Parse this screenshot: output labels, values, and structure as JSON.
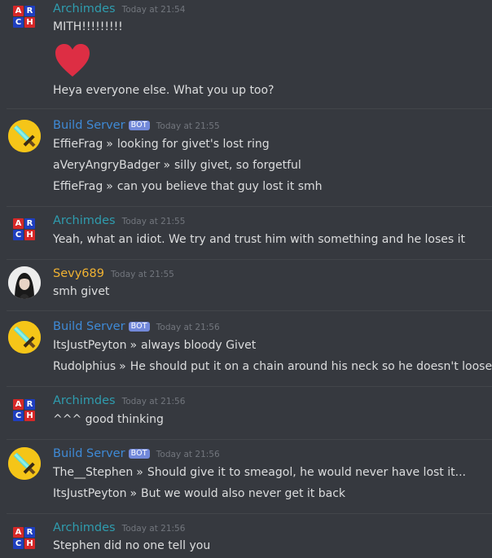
{
  "colors": {
    "background": "#36393f",
    "text": "#dcddde",
    "archimdes_name": "#2f9cae",
    "build_server_name": "#3f8ad6",
    "sevy_name": "#f0b232",
    "bot_tag": "#7289da",
    "timestamp": "#72767d",
    "heart": "#dd2e44"
  },
  "avatars": {
    "archimdes": {
      "icon": "arch-blocks-avatar-icon",
      "letters": [
        "A",
        "R",
        "C",
        "H"
      ]
    },
    "build_server": {
      "icon": "minecraft-sword-avatar-icon"
    },
    "sevy": {
      "icon": "profile-photo-avatar"
    }
  },
  "messages": [
    {
      "author": "Archimdes",
      "timestamp": "Today at 21:54",
      "lines": [
        "MITH!!!!!!!!!",
        "Heya everyone else. What you up too?"
      ],
      "emoji": "heart-emoji-icon"
    },
    {
      "author": "Build Server",
      "bot_tag": "BOT",
      "timestamp": "Today at 21:55",
      "relayed": [
        {
          "name": "EffieFrag",
          "sep": "»",
          "text": "looking for givet's lost ring"
        },
        {
          "name": "aVeryAngryBadger",
          "sep": "»",
          "text": "silly givet, so forgetful"
        },
        {
          "name": "EffieFrag",
          "sep": "»",
          "text": "can you believe that guy lost it smh"
        }
      ]
    },
    {
      "author": "Archimdes",
      "timestamp": "Today at 21:55",
      "lines": [
        "Yeah, what an idiot. We try and trust him with something and he loses it"
      ]
    },
    {
      "author": "Sevy689",
      "timestamp": "Today at 21:55",
      "lines": [
        "smh givet"
      ]
    },
    {
      "author": "Build Server",
      "bot_tag": "BOT",
      "timestamp": "Today at 21:56",
      "relayed": [
        {
          "name": "ItsJustPeyton",
          "sep": "»",
          "text": "always bloody Givet"
        },
        {
          "name": "Rudolphius",
          "sep": "»",
          "text": "He should put it on a chain around his neck so he doesn't loose it"
        }
      ]
    },
    {
      "author": "Archimdes",
      "timestamp": "Today at 21:56",
      "lines": [
        "^^^ good thinking"
      ]
    },
    {
      "author": "Build Server",
      "bot_tag": "BOT",
      "timestamp": "Today at 21:56",
      "relayed": [
        {
          "name": "The__Stephen",
          "sep": "»",
          "text": "Should give it to smeagol, he would never have lost it..."
        },
        {
          "name": "ItsJustPeyton",
          "sep": "»",
          "text": "But we would also never get it back"
        }
      ]
    },
    {
      "author": "Archimdes",
      "timestamp": "Today at 21:56",
      "lines": [
        "Stephen did no one tell you"
      ]
    }
  ]
}
